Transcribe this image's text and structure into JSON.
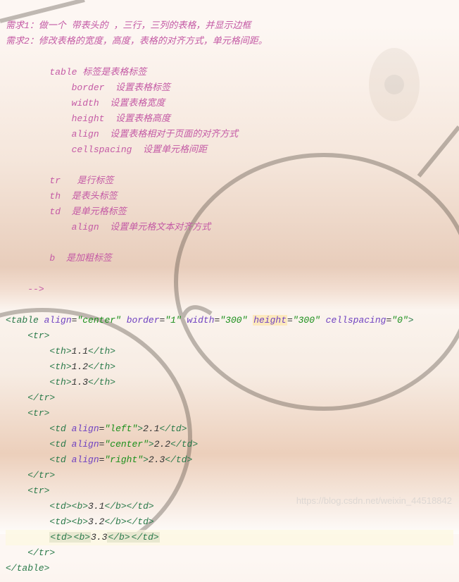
{
  "comment": {
    "req1": "需求1：做一个 带表头的 ，三行，三列的表格，并显示边框",
    "req2": "需求2：修改表格的宽度，高度，表格的对齐方式，单元格间距。",
    "tableTag": "table 标签是表格标签",
    "borderDesc": "border  设置表格标签",
    "widthDesc": "width  设置表格宽度",
    "heightDesc": "height  设置表格高度",
    "alignDesc": "align  设置表格相对于页面的对齐方式",
    "cellspacingDesc": "cellspacing  设置单元格间距",
    "trDesc": "tr   是行标签",
    "thDesc": "th  是表头标签",
    "tdDesc": "td  是单元格标签",
    "tdAlignDesc": "align  设置单元格文本对齐方式",
    "bDesc": "b  是加粗标签",
    "end": "-->"
  },
  "code": {
    "table": {
      "open": "<table",
      "close": "</table>",
      "alignAttr": "align",
      "alignVal": "\"center\"",
      "borderAttr": "border",
      "borderVal": "\"1\"",
      "widthAttr": "width",
      "widthVal": "\"300\"",
      "heightAttr": "height",
      "heightVal": "\"300\"",
      "cellspacingAttr": "cellspacing",
      "cellspacingVal": "\"0\"",
      "gt": ">"
    },
    "tr": {
      "open": "<tr>",
      "close": "</tr>"
    },
    "th": {
      "open": "<th>",
      "close": "</th>"
    },
    "td": {
      "open": "<td>",
      "close": "</td>",
      "tagName": "<td",
      "gt": ">"
    },
    "b": {
      "open": "<b>",
      "close": "</b>"
    },
    "attrAlign": "align",
    "valLeft": "\"left\"",
    "valCenter": "\"center\"",
    "valRight": "\"right\"",
    "v": {
      "h1": "1.1",
      "h2": "1.2",
      "h3": "1.3",
      "c21": "2.1",
      "c22": "2.2",
      "c23": "2.3",
      "c31": "3.1",
      "c32": "3.2",
      "c33": "3.3"
    }
  },
  "watermark": "https://blog.csdn.net/weixin_44518842"
}
